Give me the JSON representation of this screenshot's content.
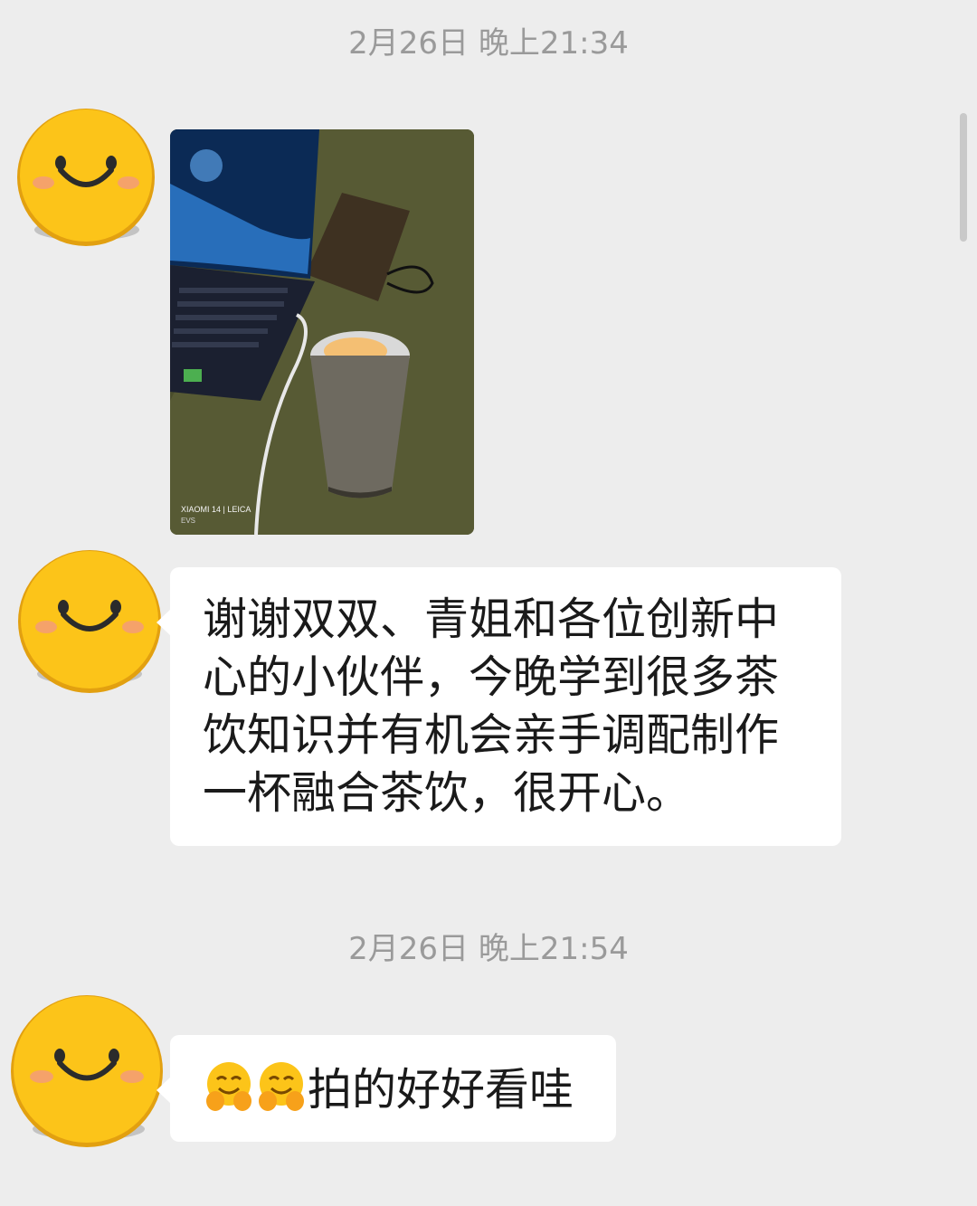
{
  "chat": {
    "timestamps": [
      "2月26日 晚上21:34",
      "2月26日 晚上21:54"
    ],
    "messages": [
      {
        "type": "image",
        "sender_avatar": "smiley-face-avatar",
        "image_alt": "photo of laptop and tumbler drink",
        "watermark_line1": "XIAOMI 14 | LEICA",
        "watermark_line2": "EVS"
      },
      {
        "type": "text",
        "sender_avatar": "smiley-face-avatar",
        "lines": [
          "谢谢双双、青姐和各位创新中",
          "心的小伙伴，今晚学到很多茶",
          "饮知识并有机会亲手调配制作",
          "一杯融合茶饮，很开心。"
        ]
      },
      {
        "type": "text",
        "sender_avatar": "smiley-face-avatar",
        "emojis": [
          "hugging-face-emoji",
          "hugging-face-emoji"
        ],
        "text": "拍的好好看哇"
      }
    ]
  },
  "colors": {
    "background": "#ededed",
    "bubble": "#ffffff",
    "timestamp_text": "#9a9a9a",
    "avatar_yellow": "#fcc419"
  }
}
